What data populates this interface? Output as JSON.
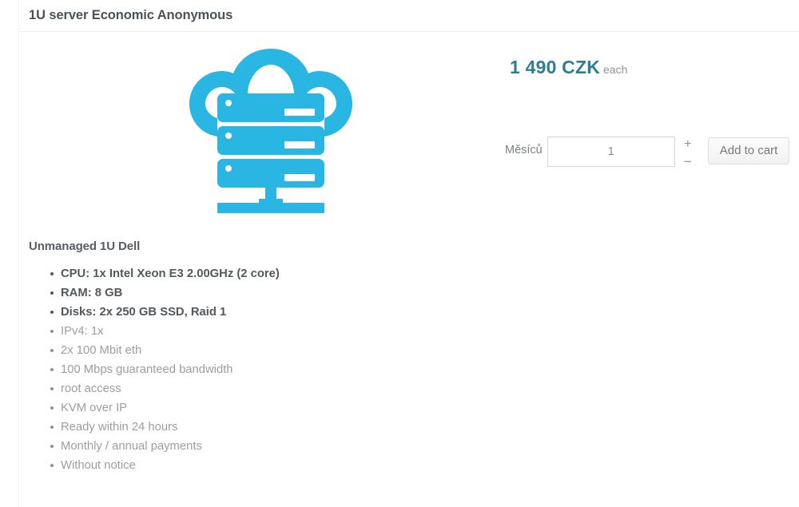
{
  "product": {
    "title": "1U server Economic Anonymous",
    "icon": "cloud-server-icon",
    "icon_color": "#29b6e3"
  },
  "pricing": {
    "amount": "1 490 CZK",
    "unit": "each",
    "accent_color": "#2e7e93"
  },
  "order_form": {
    "quantity_label": "Měsíců",
    "quantity_value": "1",
    "quantity_placeholder": "1",
    "increment_label": "+",
    "decrement_label": "−",
    "submit_label": "Add to cart"
  },
  "description": {
    "heading": "Unmanaged 1U Dell",
    "specs": [
      {
        "text": "CPU: 1x Intel Xeon E3 2.00GHz (2 core)",
        "emphasis": true
      },
      {
        "text": "RAM: 8 GB",
        "emphasis": true
      },
      {
        "text": "Disks: 2x 250 GB SSD, Raid 1",
        "emphasis": true
      },
      {
        "text": "IPv4: 1x",
        "emphasis": false
      },
      {
        "text": "2x 100 Mbit eth",
        "emphasis": false
      },
      {
        "text": "100 Mbps guaranteed bandwidth",
        "emphasis": false
      },
      {
        "text": "root access",
        "emphasis": false
      },
      {
        "text": "KVM over IP",
        "emphasis": false
      },
      {
        "text": "Ready within 24 hours",
        "emphasis": false
      },
      {
        "text": "Monthly / annual payments",
        "emphasis": false
      },
      {
        "text": "Without notice",
        "emphasis": false
      }
    ]
  }
}
